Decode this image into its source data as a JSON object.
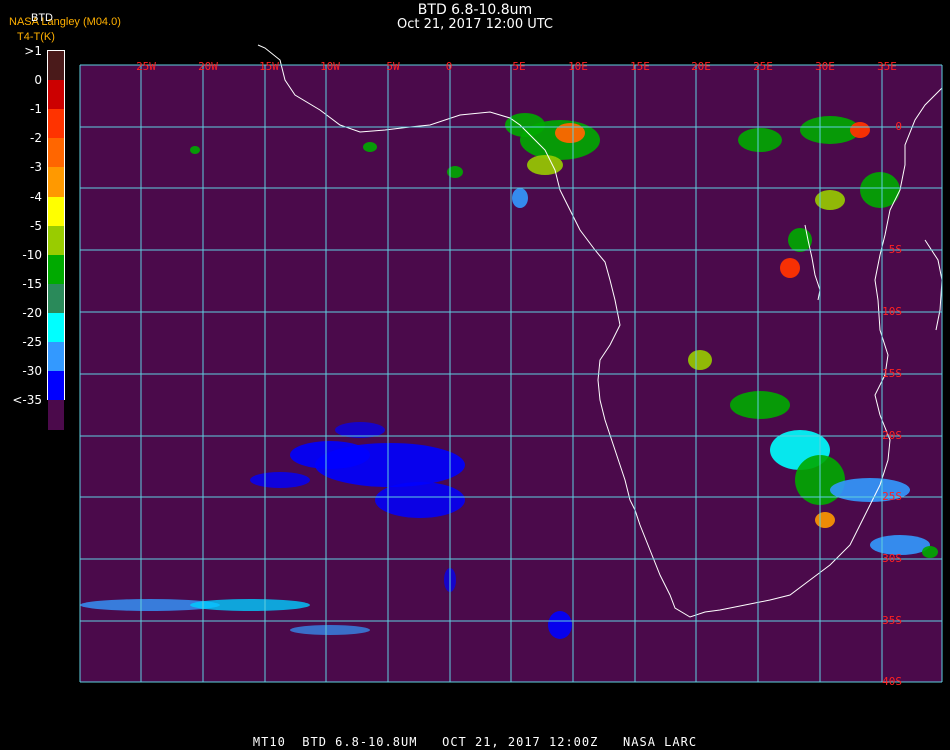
{
  "header": {
    "title": "BTD 6.8-10.8um",
    "datetime": "Oct 21, 2017 12:00 UTC"
  },
  "credit": {
    "org": "NASA Langley (M04.0)",
    "overlay": "BTD",
    "formula": "T4-T(K)"
  },
  "legend": {
    "labels": [
      ">1",
      "0",
      "-1",
      "-2",
      "-3",
      "-4",
      "-5",
      "-10",
      "-15",
      "-20",
      "-25",
      "-30",
      "<-35"
    ],
    "colors": [
      "#4a1a1a",
      "#cc0000",
      "#ff3300",
      "#ff6600",
      "#ff9900",
      "#ffff00",
      "#99cc00",
      "#00aa00",
      "#2a8a5a",
      "#00ffff",
      "#3399ff",
      "#0000ff",
      "#4b0a4b"
    ]
  },
  "map": {
    "background_color": "#4b0a4b",
    "grid_color": "#5fd0e0",
    "coast_color": "#ffffff",
    "label_color": "#ff2222",
    "lon_labels": [
      "25W",
      "20W",
      "15W",
      "10W",
      "5W",
      "0",
      "5E",
      "10E",
      "15E",
      "20E",
      "25E",
      "30E",
      "35E"
    ],
    "lat_labels": [
      "0",
      "5S",
      "10S",
      "15S",
      "20S",
      "25S",
      "30S",
      "35S",
      "40S"
    ]
  },
  "footer": {
    "text": "MT10  BTD 6.8-10.8UM   OCT 21, 2017 12:00Z   NASA LARC"
  }
}
